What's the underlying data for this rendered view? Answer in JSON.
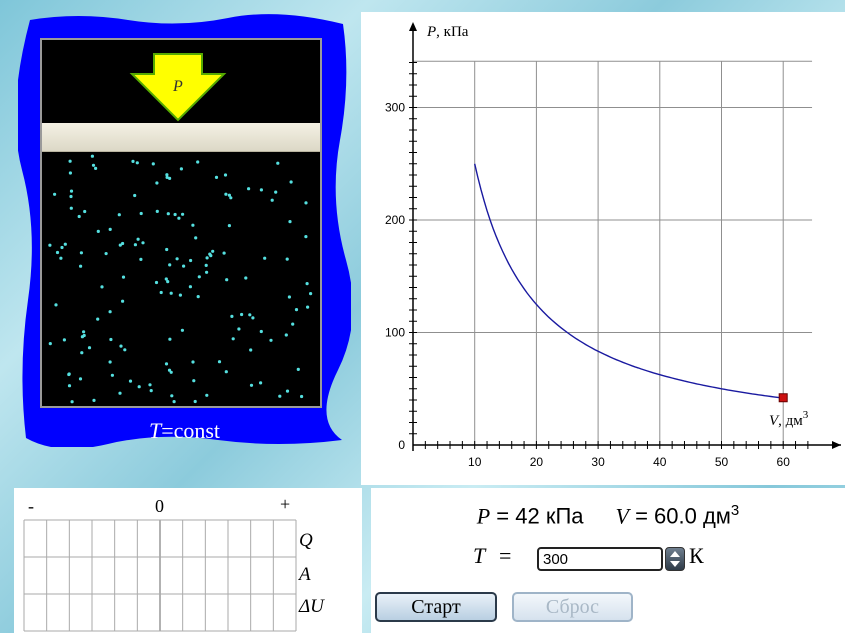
{
  "cylinder": {
    "arrow_label": "P",
    "temp_symbol": "T",
    "temp_eq": "=const"
  },
  "chart_data": {
    "type": "line",
    "xlabel": "V, дм",
    "xlabel_sup": "3",
    "ylabel": "P, кПа",
    "xlim": [
      0,
      65
    ],
    "ylim": [
      0,
      350
    ],
    "xticks": [
      10,
      20,
      30,
      40,
      50,
      60
    ],
    "yticks": [
      0,
      100,
      200,
      300
    ],
    "grid": true,
    "series": [
      {
        "x": [
          10,
          12,
          15,
          20,
          25,
          30,
          35,
          40,
          45,
          50,
          55,
          60
        ],
        "y": [
          250,
          208,
          167,
          125,
          100,
          83,
          71,
          62,
          56,
          50,
          45,
          42
        ]
      }
    ],
    "marker": {
      "x": 60,
      "y": 42
    },
    "colors": {
      "curve": "#1a1aa0",
      "marker": "#cc1111"
    }
  },
  "energy": {
    "minus": "-",
    "zero": "0",
    "plus": "+",
    "rows": [
      {
        "label": "Q"
      },
      {
        "label": "A"
      },
      {
        "label": "ΔU"
      }
    ]
  },
  "readout": {
    "p_sym": "P",
    "p_text": " = 42 кПа",
    "v_sym": "V",
    "v_text": " = 60.0 дм",
    "v_sup": "3"
  },
  "temperature": {
    "label": "T",
    "eq": "=",
    "value": "300",
    "unit": "К"
  },
  "buttons": {
    "start": "Старт",
    "reset": "Сброс"
  }
}
